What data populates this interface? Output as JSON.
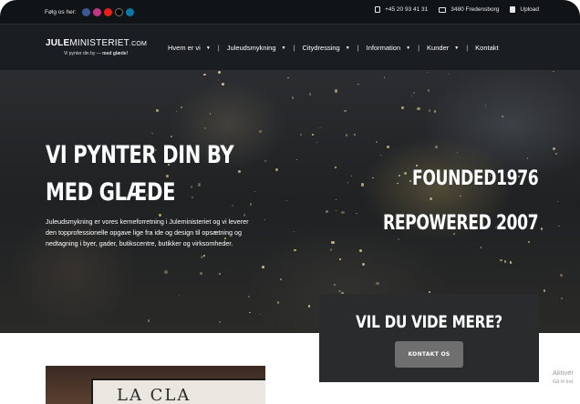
{
  "topbar": {
    "follow_label": "Følg os her:",
    "social_icons": [
      {
        "name": "facebook-icon",
        "color": "#3b5998"
      },
      {
        "name": "instagram-icon",
        "color": "#c13584"
      },
      {
        "name": "youtube-icon",
        "color": "#e62117"
      },
      {
        "name": "tiktok-icon",
        "color": "#000000"
      },
      {
        "name": "linkedin-icon",
        "color": "#0e76a8"
      }
    ],
    "phone": "+45 20 93 41 31",
    "address": "3480 Fredensborg",
    "upload": "Upload"
  },
  "logo": {
    "part1": "JULE",
    "part2": "MINISTERIET",
    "part3": ".COM",
    "tagline_1": "Vi pynter din by",
    "tagline_2": "med glæde!"
  },
  "nav": {
    "items": [
      {
        "label": "Hvem er vi",
        "dropdown": true
      },
      {
        "label": "Juleudsmykning",
        "dropdown": true
      },
      {
        "label": "Citydressing",
        "dropdown": true
      },
      {
        "label": "Information",
        "dropdown": true
      },
      {
        "label": "Kunder",
        "dropdown": true
      },
      {
        "label": "Kontakt",
        "dropdown": false
      }
    ]
  },
  "hero": {
    "title_line1": "VI PYNTER DIN BY",
    "title_line2": "MED GLÆDE",
    "text": "Juleudsmykning er vores kerneforretning i Juleministeriet og vi leverer den topprofessionelle opgave lige fra ide og design til opsætning og nedtagning i byer, gader, butikscentre, butikker og virksomheder.",
    "founded": "FOUNDED1976",
    "repowered": "REPOWERED 2007"
  },
  "cta": {
    "title": "VIL DU VIDE MERE?",
    "button": "KONTAKT OS"
  },
  "photo": {
    "sign_text": "LA CLA"
  },
  "watermark": {
    "line1": "Aktivér",
    "line2": "Gå til Ind"
  }
}
